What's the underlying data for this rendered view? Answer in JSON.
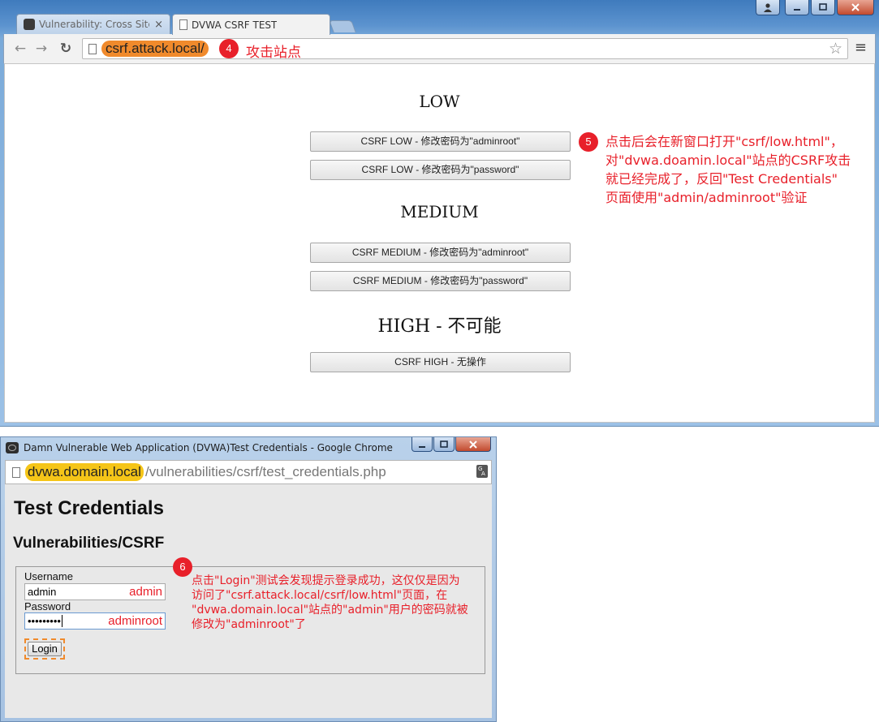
{
  "main_window": {
    "tabs": [
      {
        "title": "Vulnerability: Cross Site",
        "close": "×"
      },
      {
        "title": "DVWA CSRF TEST"
      }
    ],
    "url": "csrf.attack.local/",
    "annotation_4": {
      "number": "4",
      "text": "攻击站点"
    }
  },
  "page": {
    "sections": [
      {
        "heading": "LOW",
        "buttons": [
          "CSRF LOW - 修改密码为\"adminroot\"",
          "CSRF LOW - 修改密码为\"password\""
        ]
      },
      {
        "heading": "MEDIUM",
        "buttons": [
          "CSRF MEDIUM - 修改密码为\"adminroot\"",
          "CSRF MEDIUM - 修改密码为\"password\""
        ]
      },
      {
        "heading": "HIGH - 不可能",
        "buttons": [
          "CSRF HIGH - 无操作"
        ]
      }
    ],
    "annotation_5": {
      "number": "5",
      "lines": [
        "点击后会在新窗口打开\"csrf/low.html\"，",
        "对\"dvwa.doamin.local\"站点的CSRF攻击",
        "就已经完成了，反回\"Test Credentials\"",
        "页面使用\"admin/adminroot\"验证"
      ]
    }
  },
  "popup_window": {
    "title": "Damn Vulnerable Web Application (DVWA)Test Credentials - Google Chrome",
    "url_host": "dvwa.domain.local",
    "url_path": "/vulnerabilities/csrf/test_credentials.php",
    "page_title": "Test Credentials",
    "page_subtitle": "Vulnerabilities/CSRF",
    "username_label": "Username",
    "username_value": "admin",
    "username_annotation": "admin",
    "password_label": "Password",
    "password_value": "•••••••••",
    "password_annotation": "adminroot",
    "login_label": "Login",
    "annotation_6": {
      "number": "6",
      "lines": [
        "点击\"Login\"测试会发现提示登录成功，这仅仅是因为",
        "访问了\"csrf.attack.local/csrf/low.html\"页面，在",
        "\"dvwa.domain.local\"站点的\"admin\"用户的密码就被",
        "修改为\"adminroot\"了"
      ]
    }
  }
}
